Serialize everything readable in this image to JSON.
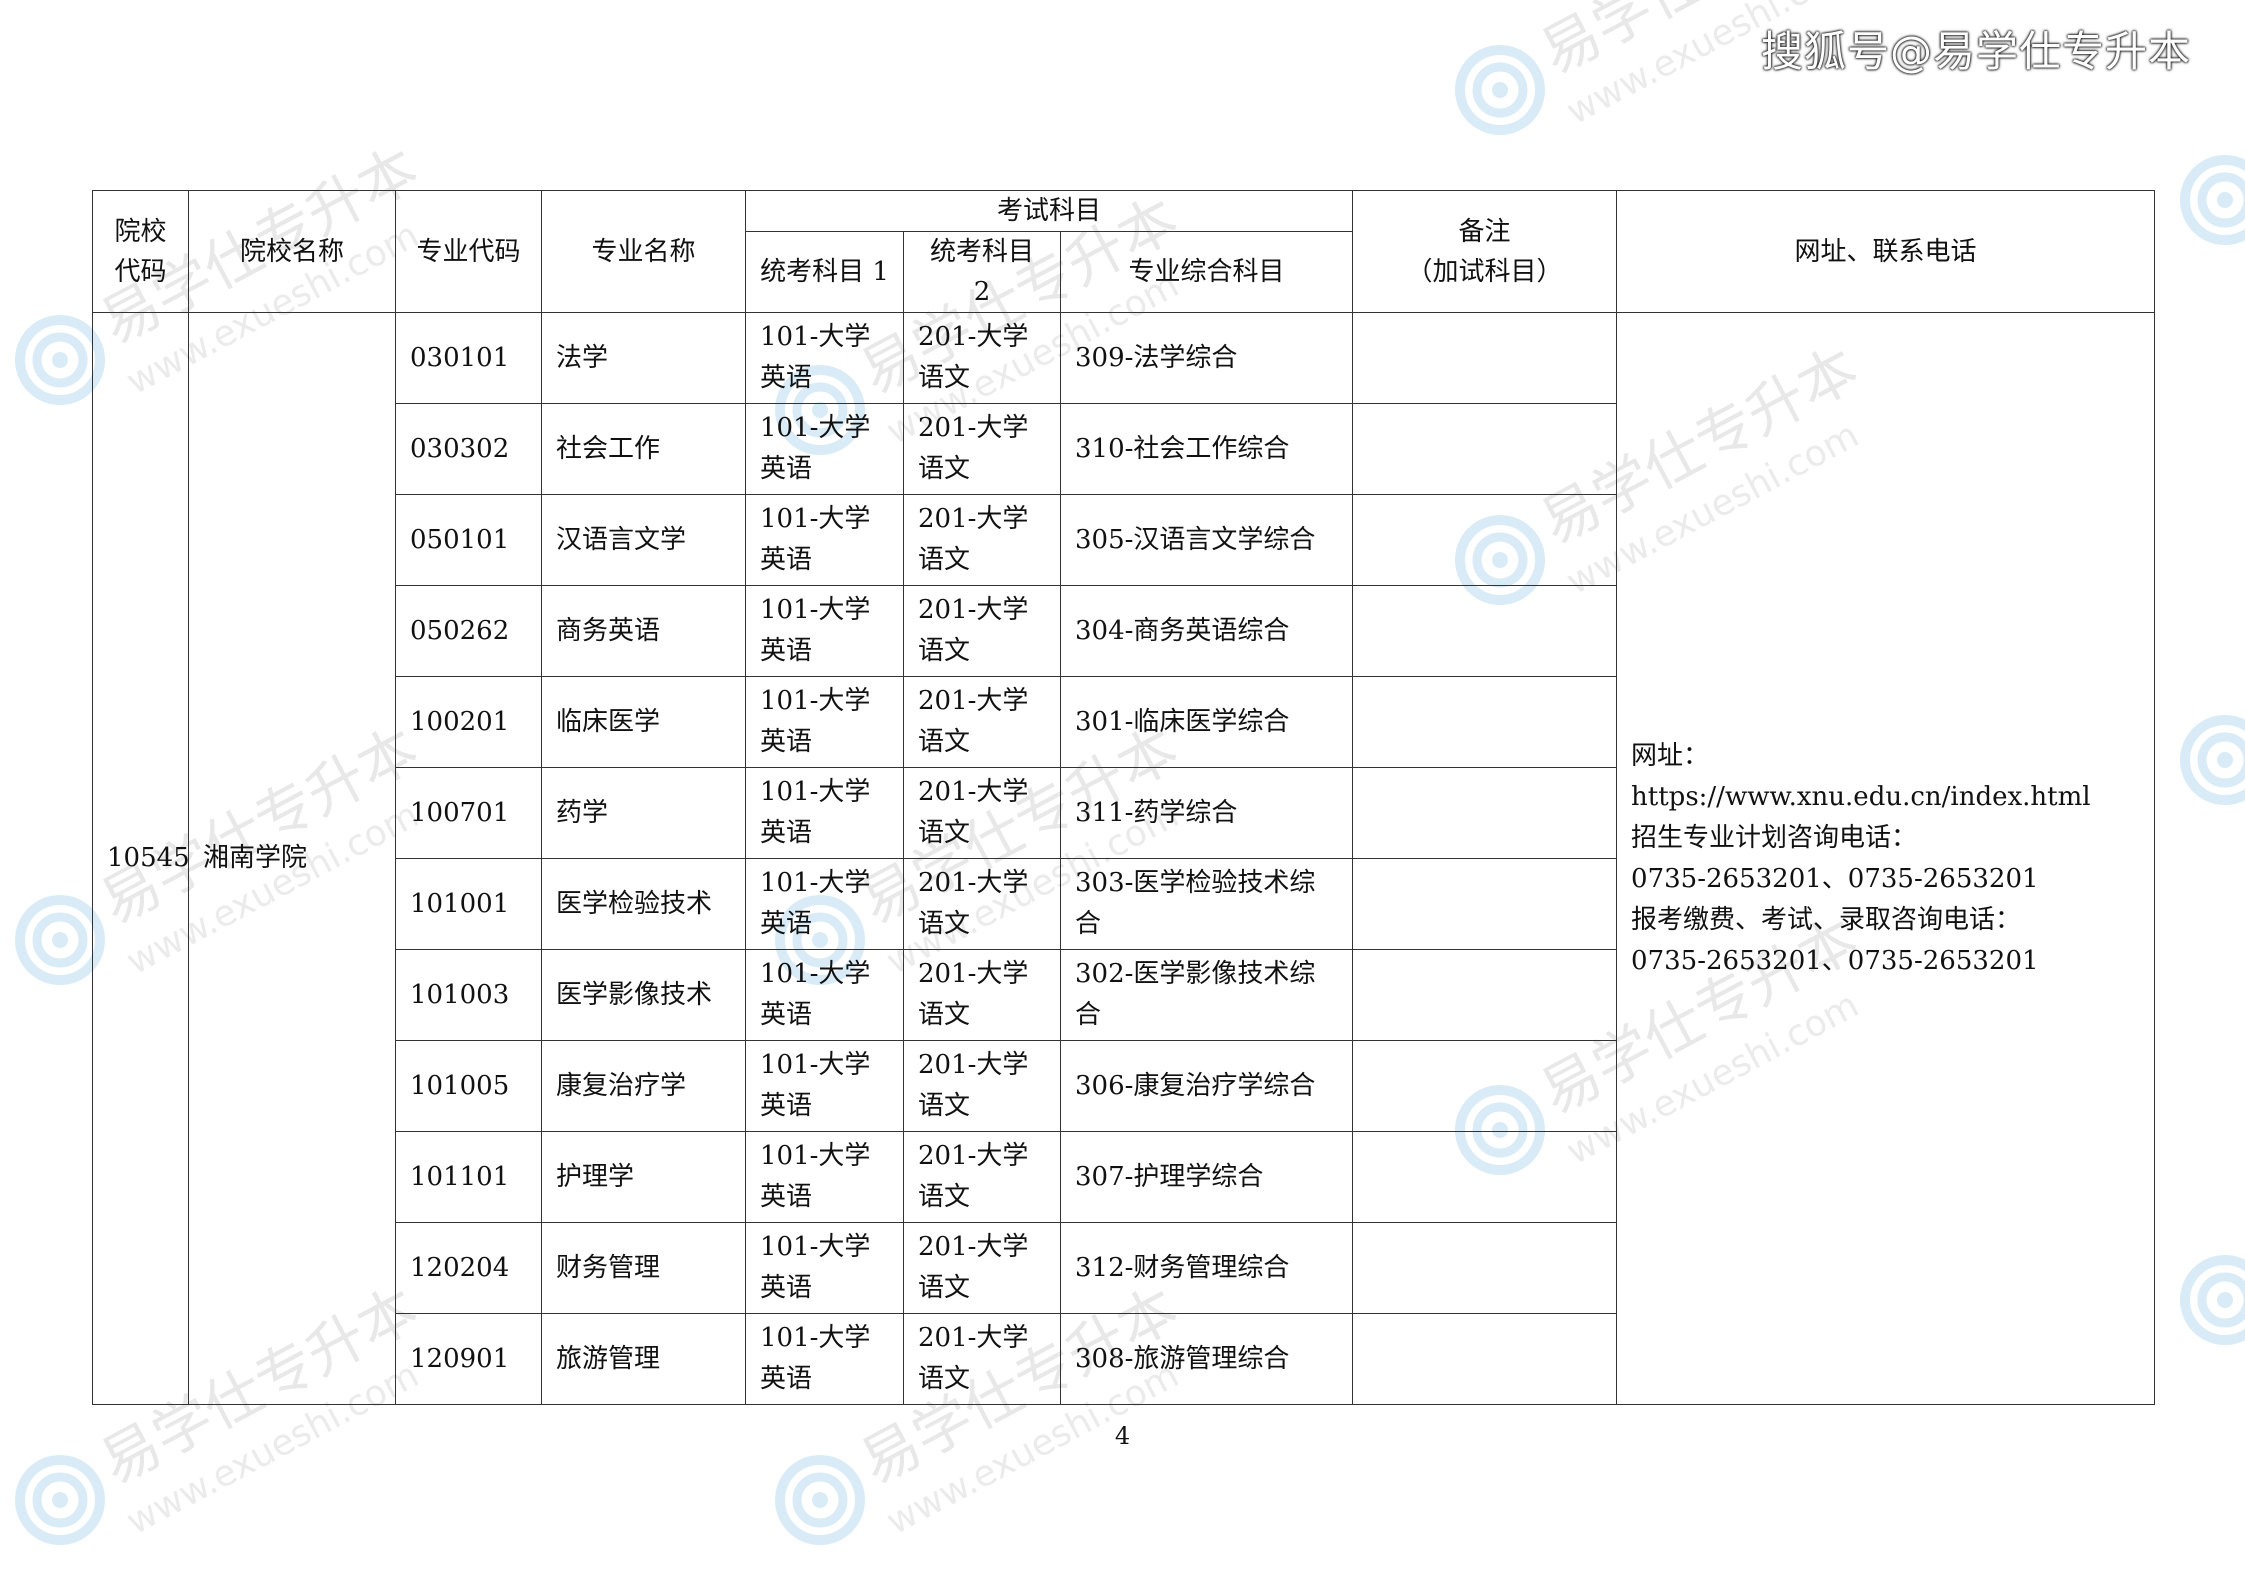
{
  "watermark": {
    "corner_text": "搜狐号@易学仕专升本",
    "brand_cn": "易学仕专升本",
    "brand_url": "www.exueshi.com"
  },
  "table": {
    "headers": {
      "school_code": [
        "院校",
        "代码"
      ],
      "school_name": "院校名称",
      "major_code": "专业代码",
      "major_name": "专业名称",
      "exam_subjects": "考试科目",
      "exam_sub": [
        "统考科目 1",
        "统考科目 2",
        "专业综合科目"
      ],
      "remarks": [
        "备注",
        "（加试科目）"
      ],
      "contact": "网址、联系电话"
    },
    "school_code": "10545",
    "school_name": "湘南学院",
    "rows": [
      {
        "code": "030101",
        "name": "法学",
        "s1": [
          "101-大学",
          "英语"
        ],
        "s2": [
          "201-大学",
          "语文"
        ],
        "comp": [
          "309-法学综合"
        ],
        "remark": ""
      },
      {
        "code": "030302",
        "name": "社会工作",
        "s1": [
          "101-大学",
          "英语"
        ],
        "s2": [
          "201-大学",
          "语文"
        ],
        "comp": [
          "310-社会工作综合"
        ],
        "remark": ""
      },
      {
        "code": "050101",
        "name": "汉语言文学",
        "s1": [
          "101-大学",
          "英语"
        ],
        "s2": [
          "201-大学",
          "语文"
        ],
        "comp": [
          "305-汉语言文学综合"
        ],
        "remark": ""
      },
      {
        "code": "050262",
        "name": "商务英语",
        "s1": [
          "101-大学",
          "英语"
        ],
        "s2": [
          "201-大学",
          "语文"
        ],
        "comp": [
          "304-商务英语综合"
        ],
        "remark": ""
      },
      {
        "code": "100201",
        "name": "临床医学",
        "s1": [
          "101-大学",
          "英语"
        ],
        "s2": [
          "201-大学",
          "语文"
        ],
        "comp": [
          "301-临床医学综合"
        ],
        "remark": ""
      },
      {
        "code": "100701",
        "name": "药学",
        "s1": [
          "101-大学",
          "英语"
        ],
        "s2": [
          "201-大学",
          "语文"
        ],
        "comp": [
          "311-药学综合"
        ],
        "remark": ""
      },
      {
        "code": "101001",
        "name": "医学检验技术",
        "s1": [
          "101-大学",
          "英语"
        ],
        "s2": [
          "201-大学",
          "语文"
        ],
        "comp": [
          "303-医学检验技术综",
          "合"
        ],
        "remark": ""
      },
      {
        "code": "101003",
        "name": "医学影像技术",
        "s1": [
          "101-大学",
          "英语"
        ],
        "s2": [
          "201-大学",
          "语文"
        ],
        "comp": [
          "302-医学影像技术综",
          "合"
        ],
        "remark": ""
      },
      {
        "code": "101005",
        "name": "康复治疗学",
        "s1": [
          "101-大学",
          "英语"
        ],
        "s2": [
          "201-大学",
          "语文"
        ],
        "comp": [
          "306-康复治疗学综合"
        ],
        "remark": ""
      },
      {
        "code": "101101",
        "name": "护理学",
        "s1": [
          "101-大学",
          "英语"
        ],
        "s2": [
          "201-大学",
          "语文"
        ],
        "comp": [
          "307-护理学综合"
        ],
        "remark": ""
      },
      {
        "code": "120204",
        "name": "财务管理",
        "s1": [
          "101-大学",
          "英语"
        ],
        "s2": [
          "201-大学",
          "语文"
        ],
        "comp": [
          "312-财务管理综合"
        ],
        "remark": ""
      },
      {
        "code": "120901",
        "name": "旅游管理",
        "s1": [
          "101-大学",
          "英语"
        ],
        "s2": [
          "201-大学",
          "语文"
        ],
        "comp": [
          "308-旅游管理综合"
        ],
        "remark": ""
      }
    ],
    "contact_lines": [
      "网址：",
      "https://www.xnu.edu.cn/index.html",
      "招生专业计划咨询电话：",
      "0735-2653201、0735-2653201",
      "报考缴费、考试、录取咨询电话：",
      "0735-2653201、0735-2653201"
    ]
  },
  "page_number": "4"
}
